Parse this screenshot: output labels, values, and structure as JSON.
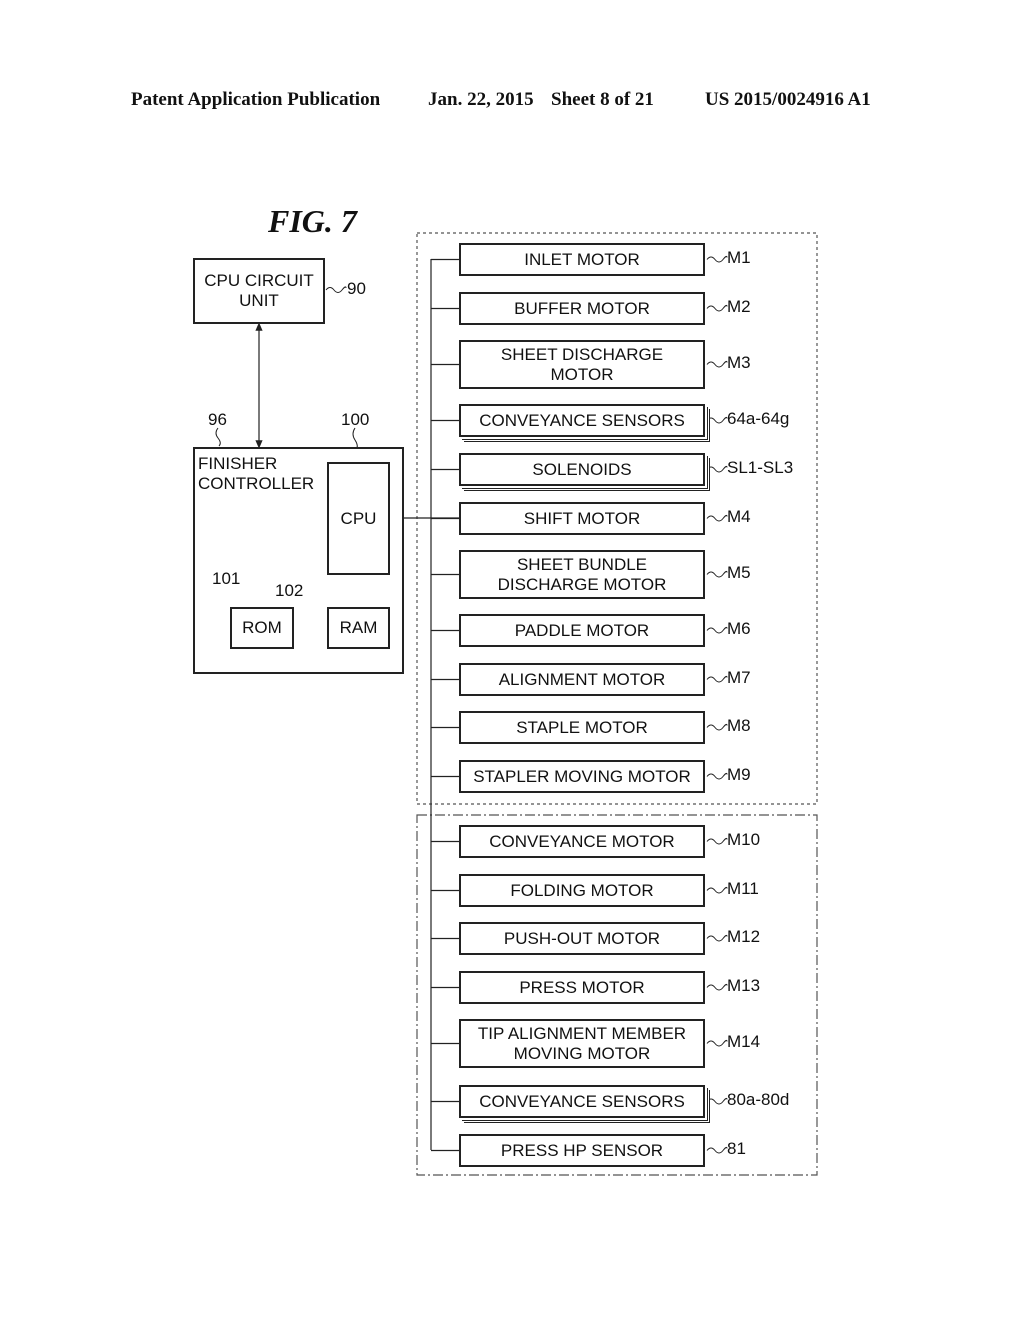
{
  "header": {
    "publication": "Patent Application Publication",
    "date": "Jan. 22, 2015",
    "sheet": "Sheet 8 of 21",
    "number": "US 2015/0024916 A1"
  },
  "figure": {
    "title": "FIG. 7",
    "cpu_circuit_unit": {
      "label": "CPU CIRCUIT UNIT",
      "line1": "CPU CIRCUIT",
      "line2": "UNIT",
      "ref": "90"
    },
    "finisher_controller": {
      "line1": "FINISHER",
      "line2": "CONTROLLER",
      "ref": "96"
    },
    "cpu": {
      "label": "CPU",
      "ref": "100"
    },
    "rom": {
      "label": "ROM",
      "ref": "101"
    },
    "ram": {
      "label": "RAM",
      "ref": "102"
    },
    "group1": [
      {
        "line1": "INLET MOTOR",
        "line2": "",
        "ref": "M1",
        "stacked": false
      },
      {
        "line1": "BUFFER MOTOR",
        "line2": "",
        "ref": "M2",
        "stacked": false
      },
      {
        "line1": "SHEET DISCHARGE",
        "line2": "MOTOR",
        "ref": "M3",
        "stacked": false
      },
      {
        "line1": "CONVEYANCE SENSORS",
        "line2": "",
        "ref": "64a-64g",
        "stacked": true
      },
      {
        "line1": "SOLENOIDS",
        "line2": "",
        "ref": "SL1-SL3",
        "stacked": true
      },
      {
        "line1": "SHIFT MOTOR",
        "line2": "",
        "ref": "M4",
        "stacked": false
      },
      {
        "line1": "SHEET BUNDLE",
        "line2": "DISCHARGE MOTOR",
        "ref": "M5",
        "stacked": false
      },
      {
        "line1": "PADDLE MOTOR",
        "line2": "",
        "ref": "M6",
        "stacked": false
      },
      {
        "line1": "ALIGNMENT MOTOR",
        "line2": "",
        "ref": "M7",
        "stacked": false
      },
      {
        "line1": "STAPLE MOTOR",
        "line2": "",
        "ref": "M8",
        "stacked": false
      },
      {
        "line1": "STAPLER MOVING MOTOR",
        "line2": "",
        "ref": "M9",
        "stacked": false
      }
    ],
    "group2": [
      {
        "line1": "CONVEYANCE MOTOR",
        "line2": "",
        "ref": "M10",
        "stacked": false
      },
      {
        "line1": "FOLDING MOTOR",
        "line2": "",
        "ref": "M11",
        "stacked": false
      },
      {
        "line1": "PUSH-OUT MOTOR",
        "line2": "",
        "ref": "M12",
        "stacked": false
      },
      {
        "line1": "PRESS MOTOR",
        "line2": "",
        "ref": "M13",
        "stacked": false
      },
      {
        "line1": "TIP ALIGNMENT MEMBER",
        "line2": "MOVING MOTOR",
        "ref": "M14",
        "stacked": false
      },
      {
        "line1": "CONVEYANCE SENSORS",
        "line2": "",
        "ref": "80a-80d",
        "stacked": true
      },
      {
        "line1": "PRESS HP SENSOR",
        "line2": "",
        "ref": "81",
        "stacked": false
      }
    ]
  }
}
